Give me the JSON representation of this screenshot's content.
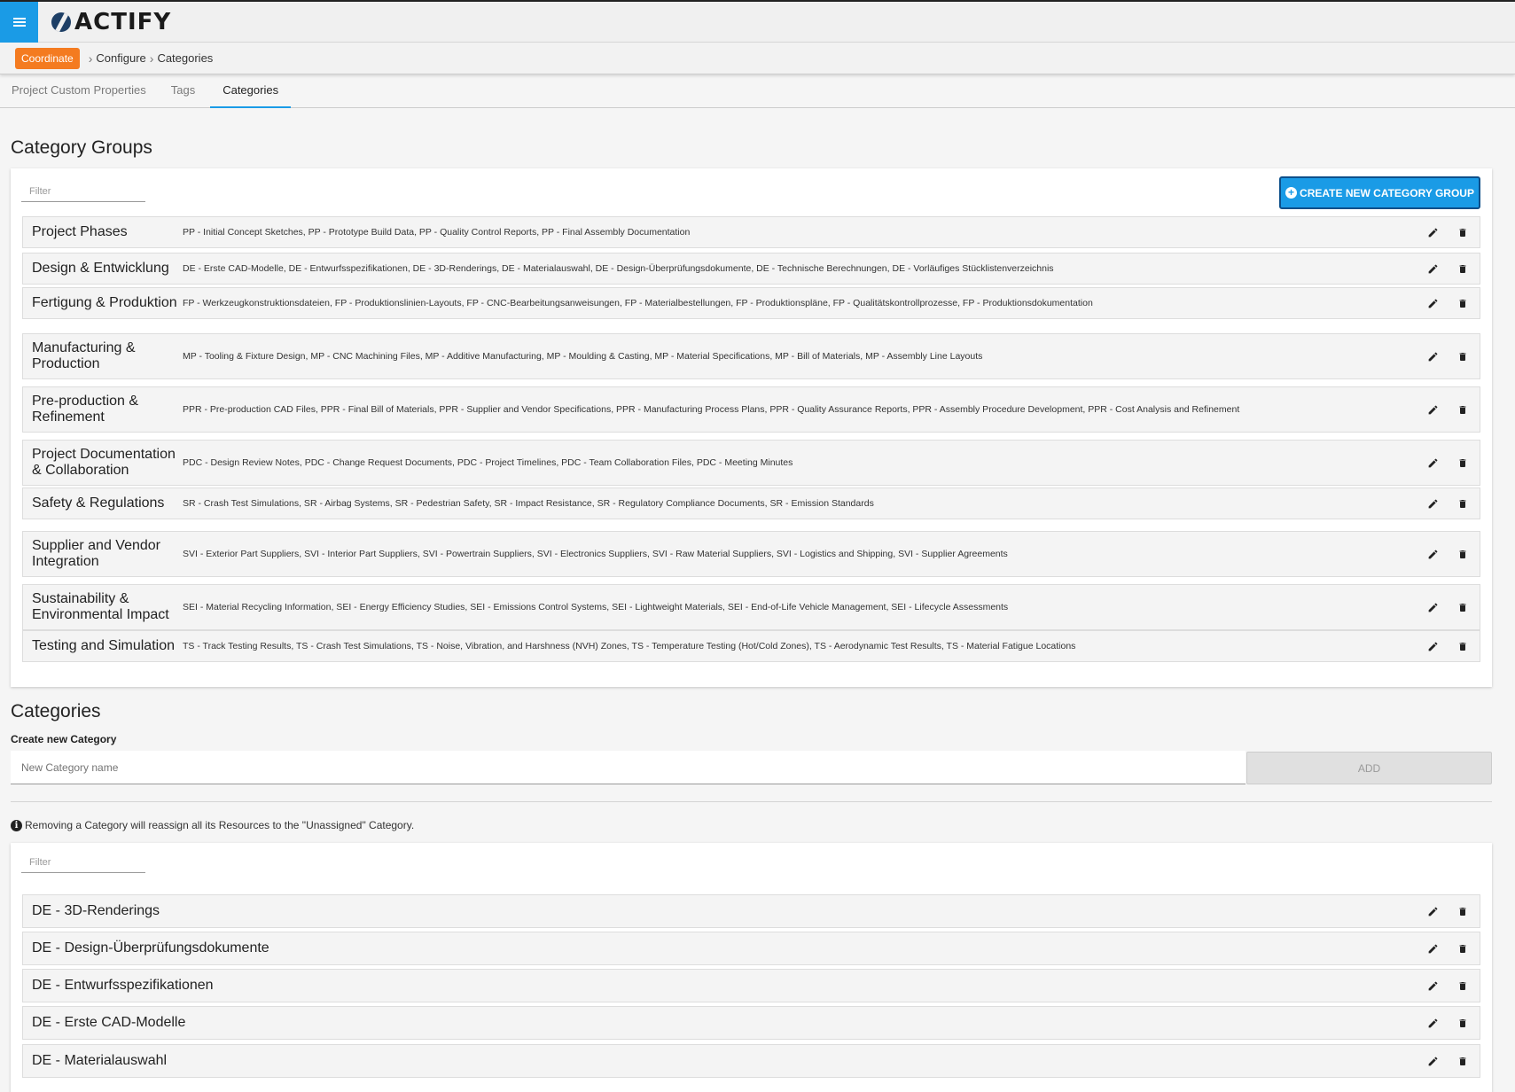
{
  "header": {
    "menu_icon": "hamburger-icon",
    "logo_text": "ACTIFY"
  },
  "breadcrumb": {
    "badge": "Coordinate",
    "items": [
      "Configure",
      "Categories"
    ]
  },
  "tabs": [
    {
      "label": "Project Custom Properties",
      "active": false
    },
    {
      "label": "Tags",
      "active": false
    },
    {
      "label": "Categories",
      "active": true
    }
  ],
  "category_groups": {
    "title": "Category Groups",
    "filter_placeholder": "Filter",
    "create_button": "CREATE NEW CATEGORY GROUP",
    "groups": [
      {
        "name": "Project Phases",
        "categories": "PP - Initial Concept Sketches, PP - Prototype Build Data, PP - Quality Control Reports, PP - Final Assembly Documentation"
      },
      {
        "name": "Design & Entwicklung",
        "categories": "DE - Erste CAD-Modelle, DE - Entwurfsspezifikationen, DE - 3D-Renderings, DE - Materialauswahl, DE - Design-Überprüfungsdokumente, DE - Technische Berechnungen, DE - Vorläufiges Stücklistenverzeichnis"
      },
      {
        "name": "Fertigung & Produktion",
        "categories": "FP - Werkzeugkonstruktionsdateien, FP - Produktionslinien-Layouts, FP - CNC-Bearbeitungsanweisungen, FP - Materialbestellungen, FP - Produktionspläne, FP - Qualitätskontrollprozesse, FP - Produktionsdokumentation"
      },
      {
        "name": "Manufacturing & Production",
        "categories": "MP - Tooling & Fixture Design, MP - CNC Machining Files, MP - Additive Manufacturing, MP - Moulding & Casting, MP - Material Specifications, MP - Bill of Materials, MP - Assembly Line Layouts"
      },
      {
        "name": "Pre-production & Refinement",
        "categories": "PPR - Pre-production CAD Files, PPR - Final Bill of Materials, PPR - Supplier and Vendor Specifications, PPR - Manufacturing Process Plans, PPR - Quality Assurance Reports, PPR - Assembly Procedure Development, PPR - Cost Analysis and Refinement"
      },
      {
        "name": "Project Documentation & Collaboration",
        "categories": "PDC - Design Review Notes, PDC - Change Request Documents, PDC - Project Timelines, PDC - Team Collaboration Files, PDC - Meeting Minutes"
      },
      {
        "name": "Safety & Regulations",
        "categories": "SR - Crash Test Simulations, SR - Airbag Systems, SR - Pedestrian Safety, SR - Impact Resistance, SR - Regulatory Compliance Documents, SR - Emission Standards"
      },
      {
        "name": "Supplier and Vendor Integration",
        "categories": "SVI - Exterior Part Suppliers, SVI - Interior Part Suppliers, SVI - Powertrain Suppliers, SVI - Electronics Suppliers, SVI - Raw Material Suppliers, SVI - Logistics and Shipping, SVI - Supplier Agreements"
      },
      {
        "name": "Sustainability & Environmental Impact",
        "categories": "SEI - Material Recycling Information, SEI - Energy Efficiency Studies, SEI - Emissions Control Systems, SEI - Lightweight Materials, SEI - End-of-Life Vehicle Management, SEI - Lifecycle Assessments"
      },
      {
        "name": "Testing and Simulation",
        "categories": "TS - Track Testing Results, TS - Crash Test Simulations, TS - Noise, Vibration, and Harshness (NVH) Zones, TS - Temperature Testing (Hot/Cold Zones), TS - Aerodynamic Test Results, TS - Material Fatigue Locations"
      }
    ]
  },
  "categories": {
    "title": "Categories",
    "create_label": "Create new Category",
    "input_placeholder": "New Category name",
    "add_button": "ADD",
    "info_text": "Removing a Category will reassign all its Resources to the \"Unassigned\" Category.",
    "filter_placeholder": "Filter",
    "items": [
      "DE - 3D-Renderings",
      "DE - Design-Überprüfungsdokumente",
      "DE - Entwurfsspezifikationen",
      "DE - Erste CAD-Modelle",
      "DE - Materialauswahl"
    ]
  },
  "colors": {
    "accent": "#1a9be6",
    "badge": "#f47b20"
  }
}
